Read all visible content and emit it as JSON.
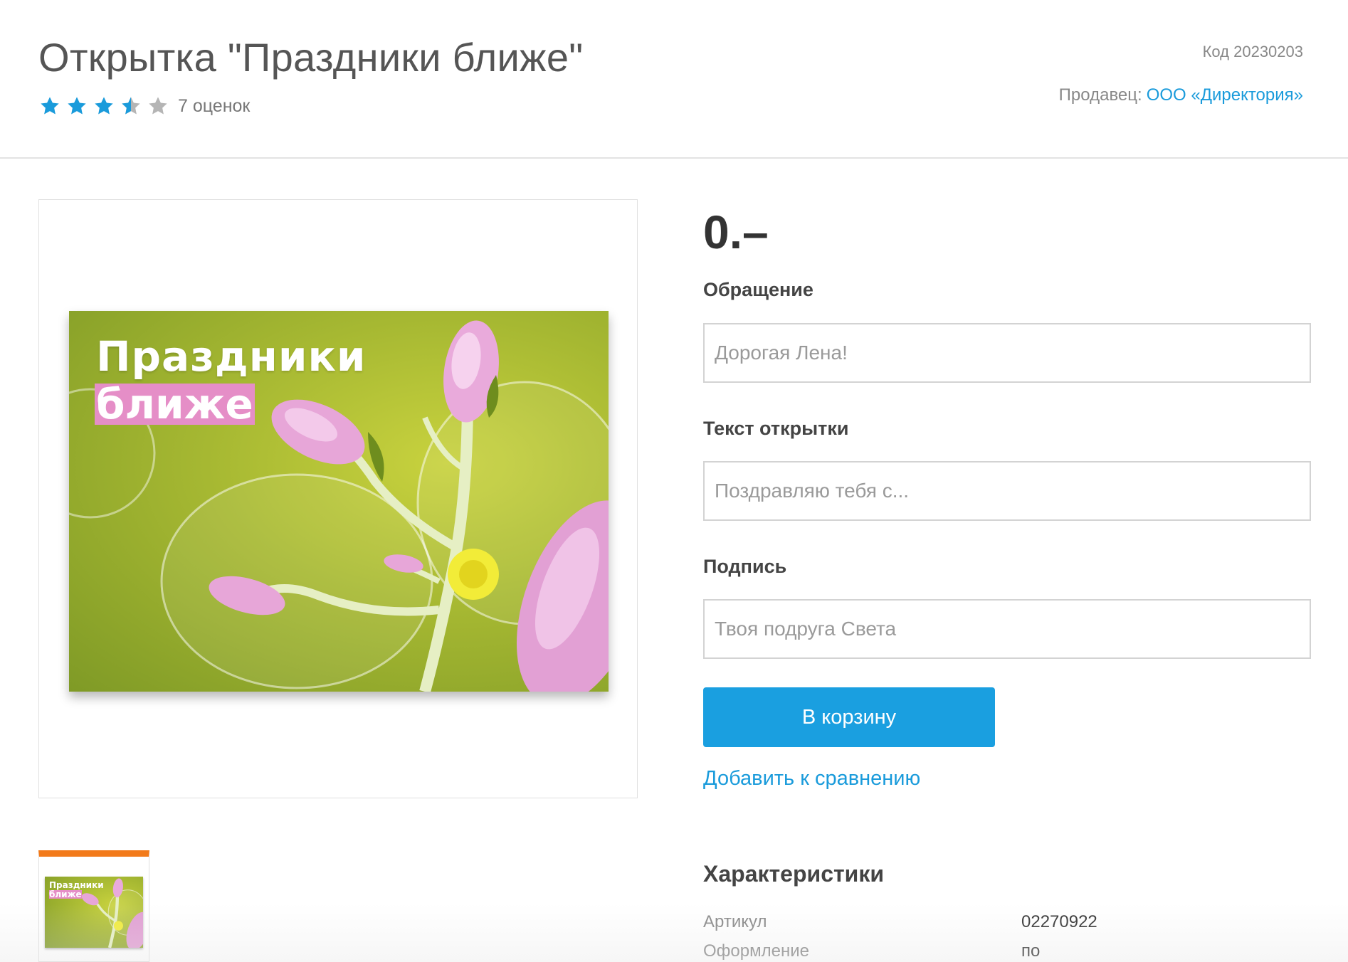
{
  "product": {
    "title": "Открытка \"Праздники ближе\"",
    "code": "Код 20230203",
    "seller_label": "Продавец:",
    "seller_name": "ООО «Директория»",
    "rating": {
      "value": 3.5,
      "max": 5,
      "count_text": "7 оценок"
    },
    "price": "0.–"
  },
  "image": {
    "line1": "Праздники",
    "line2": "ближе"
  },
  "form": {
    "greeting": {
      "label": "Обращение",
      "placeholder": "Дорогая Лена!"
    },
    "text": {
      "label": "Текст открытки",
      "placeholder": "Поздравляю тебя с..."
    },
    "signature": {
      "label": "Подпись",
      "placeholder": "Твоя подруга Света"
    },
    "cart_button": "В корзину",
    "compare_link": "Добавить к сравнению"
  },
  "specs": {
    "title": "Характеристики",
    "rows": [
      {
        "name": "Артикул",
        "value": "02270922"
      },
      {
        "name": "Оформление",
        "value": "по"
      }
    ]
  },
  "colors": {
    "accent": "#1a9fe0",
    "link": "#1a9bdb",
    "star_active": "#1a9bdb",
    "star_inactive": "#b5b5b5",
    "thumb_active": "#f27a1a"
  },
  "icons": [
    "star-full-icon",
    "star-half-icon",
    "star-empty-icon"
  ]
}
